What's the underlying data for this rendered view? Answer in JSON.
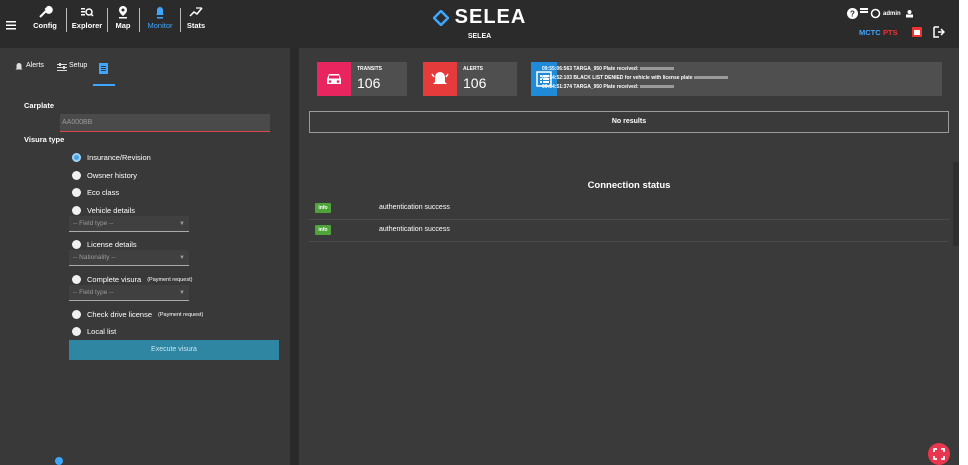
{
  "nav": {
    "items": [
      {
        "label": "Config"
      },
      {
        "label": "Explorer"
      },
      {
        "label": "Map"
      },
      {
        "label": "Monitor"
      },
      {
        "label": "Stats"
      }
    ],
    "active_color": "#3ea6ff"
  },
  "brand": {
    "logo": "SELEA",
    "subtitle": "SELEA"
  },
  "topright": {
    "user": "admin",
    "mctc": "MCTC",
    "plate_code": "PTS"
  },
  "left_tabs": {
    "alerts": "Alerts",
    "setup": "Setup"
  },
  "form": {
    "carplate_label": "Carplate",
    "carplate_placeholder": "AA000BB",
    "visura_type_label": "Visura type",
    "options": [
      {
        "label": "Insurance/Revision",
        "selected": true
      },
      {
        "label": "Owsner history"
      },
      {
        "label": "Eco class"
      },
      {
        "label": "Vehicle details",
        "select": "-- Field type --"
      },
      {
        "label": "License details",
        "select": "-- Nationality --"
      },
      {
        "label": "Complete visura",
        "note": "(Payment request)",
        "select": "-- Field type --"
      },
      {
        "label": "Check drive license",
        "note": "(Payment request)"
      },
      {
        "label": "Local list"
      }
    ],
    "execute_label": "Execute visura"
  },
  "cards": {
    "transits": {
      "title": "TRANSITS",
      "value": "106",
      "color": "#e8255f"
    },
    "alerts": {
      "title": "ALERTS",
      "value": "106",
      "color": "#e63b3b"
    }
  },
  "log": {
    "color": "#1e8ad8",
    "lines": [
      "09:55:06:563 TARGA_950 Plate received:",
      "09:54:52:103 BLACK LIST DENIED for vehicle with license plate",
      "09:54:51:374 TARGA_950 Plate received:"
    ]
  },
  "results": {
    "no_results": "No results"
  },
  "connection": {
    "title": "Connection status",
    "rows": [
      {
        "badge": "info",
        "message": "authentication success"
      },
      {
        "badge": "info",
        "message": "authentication success"
      }
    ]
  }
}
